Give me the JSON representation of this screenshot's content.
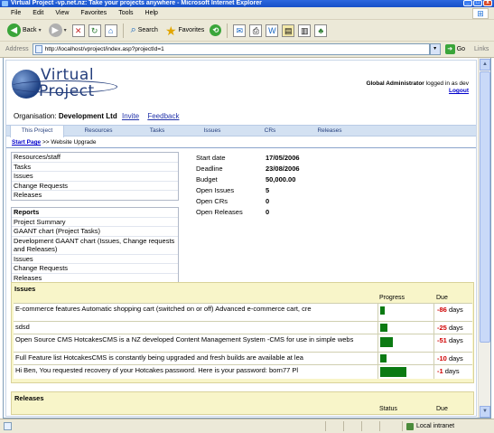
{
  "window": {
    "title": "Virtual Project -vp.net.nz: Take your projects anywhere - Microsoft Internet Explorer",
    "min": "_",
    "max": "□",
    "close": "x"
  },
  "menu": [
    "File",
    "Edit",
    "View",
    "Favorites",
    "Tools",
    "Help"
  ],
  "toolbar": {
    "back": "Back",
    "search": "Search",
    "favorites": "Favorites"
  },
  "address": {
    "label": "Address",
    "url": "http://localhost/vproject/index.asp?projectId=1",
    "go": "Go",
    "links": "Links"
  },
  "logo": {
    "line1": "Virtual",
    "line2": "Project"
  },
  "user": {
    "name": "Global Administrator",
    "status": "logged in as dev",
    "logout": "Logout"
  },
  "org": {
    "label": "Organisation:",
    "name": "Development Ltd",
    "invite": "Invite",
    "feedback": "Feedback"
  },
  "tabs": [
    "This Project",
    "Resources",
    "Tasks",
    "Issues",
    "CRs",
    "Releases"
  ],
  "breadcrumb": {
    "start": "Start Page",
    "sep": ">>",
    "current": "Website Upgrade"
  },
  "side_menu": [
    "Resources/staff",
    "Tasks",
    "Issues",
    "Change Requests",
    "Releases"
  ],
  "reports": {
    "title": "Reports",
    "items": [
      "Project Summary",
      "GAANT chart (Project Tasks)",
      "Development GAANT chart (Issues, Change requests and Releases)",
      "Issues",
      "Change Requests",
      "Releases"
    ]
  },
  "project_info": [
    {
      "label": "Start date",
      "value": "17/05/2006"
    },
    {
      "label": "Deadline",
      "value": "23/08/2006"
    },
    {
      "label": "Budget",
      "value": "50,000.00"
    },
    {
      "label": "Open Issues",
      "value": "5"
    },
    {
      "label": "Open CRs",
      "value": "0"
    },
    {
      "label": "Open Releases",
      "value": "0"
    }
  ],
  "issues_panel": {
    "title": "Issues",
    "progress_header": "Progress",
    "due_header": "Due",
    "rows": [
      {
        "text": "E-commerce features Automatic shopping cart (switched on or off) Advanced e-commerce cart, cre",
        "progress": 0.09,
        "due": "-86",
        "unit": "days"
      },
      {
        "text": "sdsd",
        "progress": 0.14,
        "due": "-25",
        "unit": "days"
      },
      {
        "text": "Open Source CMS HotcakesCMS is a NZ developed Content Management System -CMS for use in simple webs",
        "progress": 0.24,
        "due": "-51",
        "unit": "days"
      },
      {
        "text": "Full Feature list HotcakesCMS is constantly being upgraded and fresh builds are available at lea",
        "progress": 0.12,
        "due": "-10",
        "unit": "days"
      },
      {
        "text": "Hi Ben, You requested recovery of your Hotcakes password. Here is your password: born77 Pl",
        "progress": 0.5,
        "due": "-1",
        "unit": "days"
      }
    ]
  },
  "releases_panel": {
    "title": "Releases",
    "status_header": "Status",
    "due_header": "Due"
  },
  "statusbar": {
    "zone": "Local intranet"
  }
}
